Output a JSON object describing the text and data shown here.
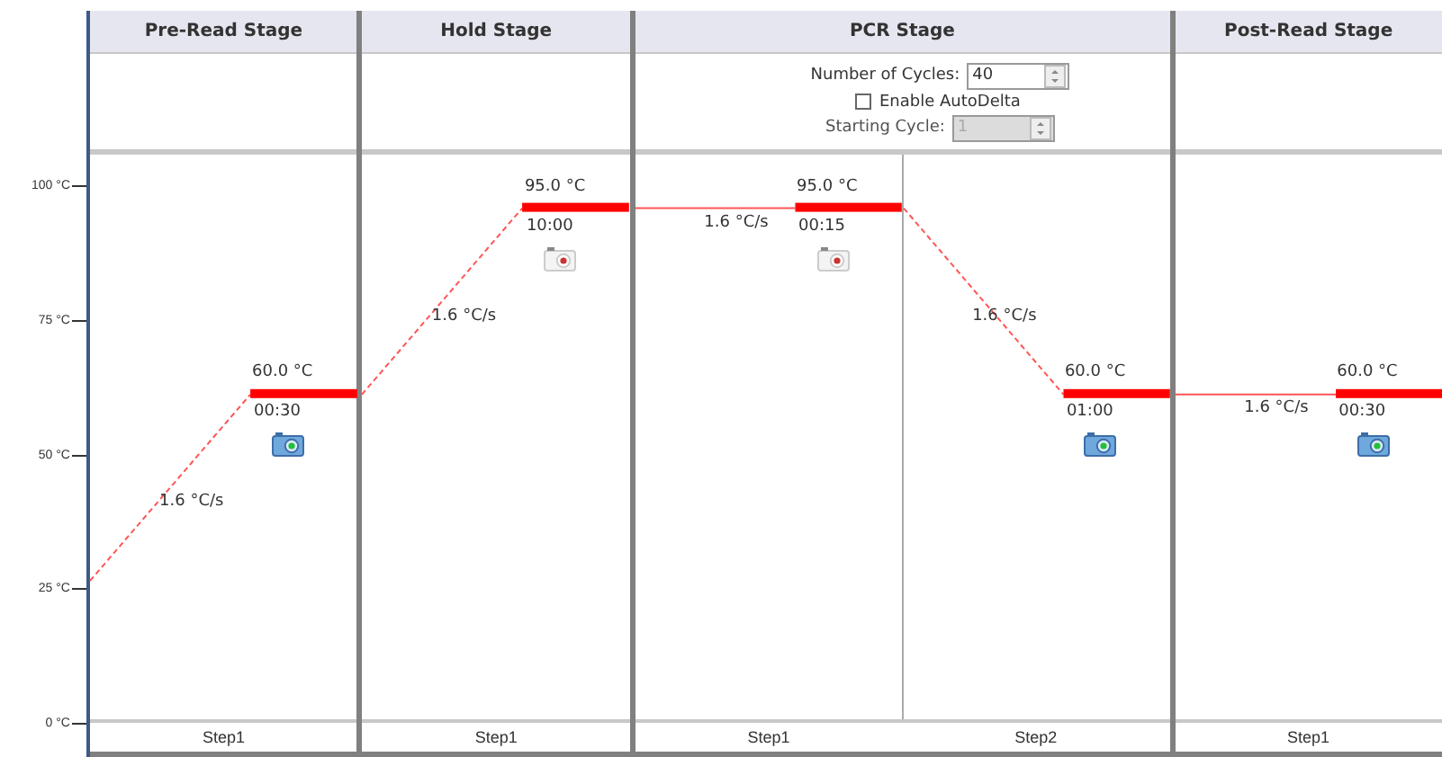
{
  "axis": {
    "ticks": [
      "100 °C",
      "75 °C",
      "50 °C",
      "25 °C",
      "0 °C"
    ]
  },
  "stages": [
    {
      "title": "Pre-Read Stage",
      "steps": [
        {
          "label": "Step1",
          "ramp_rate": "1.6 °C/s",
          "temperature": "60.0 °C",
          "time": "00:30",
          "level": 0.6,
          "data_collection": true
        }
      ]
    },
    {
      "title": "Hold Stage",
      "steps": [
        {
          "label": "Step1",
          "ramp_rate": "1.6 °C/s",
          "temperature": "95.0 °C",
          "time": "10:00",
          "level": 0.95,
          "data_collection": false
        }
      ]
    },
    {
      "title": "PCR Stage",
      "settings": {
        "cycles": {
          "label": "Number of Cycles:",
          "value": "40"
        },
        "auto_delta": {
          "label": "Enable AutoDelta",
          "checked": false
        },
        "starting_cycle": {
          "label": "Starting Cycle:",
          "value": "1",
          "disabled": true
        }
      },
      "steps": [
        {
          "label": "Step1",
          "ramp_rate": "1.6 °C/s",
          "temperature": "95.0 °C",
          "time": "00:15",
          "level": 0.95,
          "data_collection": false
        },
        {
          "label": "Step2",
          "ramp_rate": "1.6 °C/s",
          "temperature": "60.0 °C",
          "time": "01:00",
          "level": 0.6,
          "data_collection": true
        }
      ]
    },
    {
      "title": "Post-Read Stage",
      "steps": [
        {
          "label": "Step1",
          "ramp_rate": "1.6 °C/s",
          "temperature": "60.0 °C",
          "time": "00:30",
          "level": 0.6,
          "data_collection": true
        }
      ]
    }
  ]
}
